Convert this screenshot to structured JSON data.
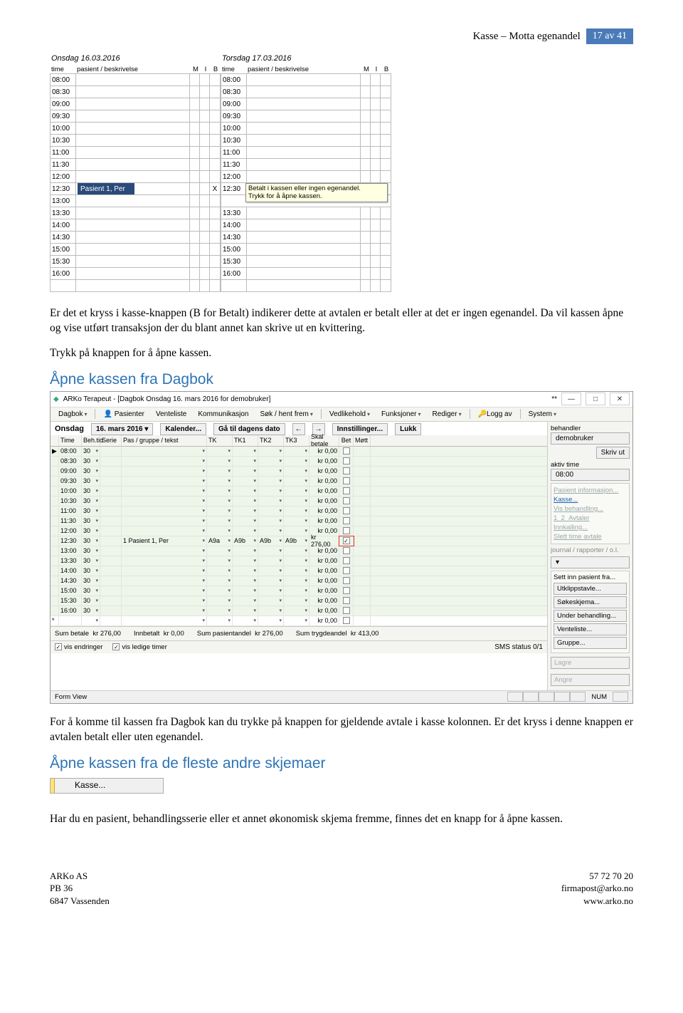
{
  "header": {
    "title": "Kasse – Motta egenandel",
    "page_badge": "17 av 41"
  },
  "schedule": {
    "day1_title": "Onsdag 16.03.2016",
    "day2_title": "Torsdag 17.03.2016",
    "col_time": "time",
    "col_patient": "pasient / beskrivelse",
    "col_m": "M",
    "col_i": "I",
    "col_b": "B",
    "times": [
      "08:00",
      "08:30",
      "09:00",
      "09:30",
      "10:00",
      "10:30",
      "11:00",
      "11:30",
      "12:00",
      "12:30",
      "13:00",
      "13:30",
      "14:00",
      "14:30",
      "15:00",
      "15:30",
      "16:00"
    ],
    "selected_time": "12:30",
    "selected_patient": "Pasient 1, Per",
    "selected_b": "X",
    "tooltip_line1": "Betalt i kassen eller ingen egenandel.",
    "tooltip_line2": "Trykk for å åpne kassen."
  },
  "text": {
    "p1": "Er det et kryss i kasse-knappen (B for Betalt) indikerer dette at avtalen er betalt eller at det er ingen egenandel. Da vil kassen åpne og vise utført transaksjon der du blant annet kan skrive ut en kvittering.",
    "p2": "Trykk på knappen for å åpne kassen.",
    "h_dagbok": "Åpne kassen fra Dagbok",
    "p3": "For å komme til kassen fra Dagbok kan du trykke på knappen for gjeldende avtale i kasse kolonnen. Er det kryss i denne knappen er avtalen betalt eller uten egenandel.",
    "h_other": "Åpne kassen fra de fleste andre skjemaer",
    "p4": "Har du en pasient, behandlingsserie eller et annet økonomisk skjema fremme, finnes det en knapp for å åpne kassen.",
    "kasse_button": "Kasse..."
  },
  "app": {
    "title": "ARKo Terapeut - [Dagbok  Onsdag 16. mars 2016 for demobruker]",
    "win_min": "—",
    "win_max": "□",
    "win_close": "✕",
    "star": "**",
    "menu": [
      "Dagbok",
      "Pasienter",
      "Venteliste",
      "Kommunikasjon",
      "Søk / hent frem",
      "Vedlikehold",
      "Funksjoner",
      "Rediger",
      "Logg av",
      "System"
    ],
    "menu_caret": [
      true,
      false,
      false,
      false,
      true,
      true,
      true,
      true,
      false,
      true
    ],
    "menu_icon_pas": "👤",
    "toolbar": {
      "day_label": "Onsdag",
      "date": "16. mars 2016",
      "kalender": "Kalender...",
      "gaatil": "Gå til dagens dato",
      "prev": "←",
      "next": "→",
      "innst": "Innstillinger...",
      "lukk": "Lukk"
    },
    "side": {
      "behandler_label": "behandler",
      "behandler_value": "demobruker",
      "skrivut": "Skriv ut",
      "aktiv_label": "aktiv time",
      "aktiv_value": "08:00",
      "pasientinfo": "Pasient informasjon...",
      "kasse": "Kasse...",
      "visbeh": "Vis behandling...",
      "avtaler": "Avtaler",
      "innkalling": "Innkalling...",
      "slett": "Slett time avtale",
      "journal": "journal / rapporter / o.l.",
      "settinn": "Sett inn pasient fra...",
      "utklipp": "Utklippstavle...",
      "soke": "Søkeskjema...",
      "under": "Under behandling...",
      "vente": "Venteliste...",
      "gruppe": "Gruppe...",
      "lagre": "Lagre",
      "angre": "Angre"
    },
    "grid": {
      "headers": [
        "Time",
        "Beh.tid",
        "Serie",
        "Pas / gruppe / tekst",
        "TK",
        "TK1",
        "TK2",
        "TK3",
        "Skal betale",
        "Bet",
        "Møtt"
      ],
      "rows": [
        {
          "time": "08:00",
          "beh": "30",
          "pas": "",
          "tk": [
            "",
            "",
            "",
            ""
          ],
          "sk": "kr 0,00",
          "bet": false,
          "hl": false
        },
        {
          "time": "08:30",
          "beh": "30",
          "pas": "",
          "tk": [
            "",
            "",
            "",
            ""
          ],
          "sk": "kr 0,00",
          "bet": false,
          "hl": false
        },
        {
          "time": "09:00",
          "beh": "30",
          "pas": "",
          "tk": [
            "",
            "",
            "",
            ""
          ],
          "sk": "kr 0,00",
          "bet": false,
          "hl": false
        },
        {
          "time": "09:30",
          "beh": "30",
          "pas": "",
          "tk": [
            "",
            "",
            "",
            ""
          ],
          "sk": "kr 0,00",
          "bet": false,
          "hl": false
        },
        {
          "time": "10:00",
          "beh": "30",
          "pas": "",
          "tk": [
            "",
            "",
            "",
            ""
          ],
          "sk": "kr 0,00",
          "bet": false,
          "hl": false
        },
        {
          "time": "10:30",
          "beh": "30",
          "pas": "",
          "tk": [
            "",
            "",
            "",
            ""
          ],
          "sk": "kr 0,00",
          "bet": false,
          "hl": false
        },
        {
          "time": "11:00",
          "beh": "30",
          "pas": "",
          "tk": [
            "",
            "",
            "",
            ""
          ],
          "sk": "kr 0,00",
          "bet": false,
          "hl": false
        },
        {
          "time": "11:30",
          "beh": "30",
          "pas": "",
          "tk": [
            "",
            "",
            "",
            ""
          ],
          "sk": "kr 0,00",
          "bet": false,
          "hl": false
        },
        {
          "time": "12:00",
          "beh": "30",
          "pas": "",
          "tk": [
            "",
            "",
            "",
            ""
          ],
          "sk": "kr 0,00",
          "bet": false,
          "hl": false
        },
        {
          "time": "12:30",
          "beh": "30",
          "pas": "1 Pasient 1, Per",
          "tk": [
            "A9a",
            "A9b",
            "A9b",
            "A9b"
          ],
          "sk": "kr 276,00",
          "bet": true,
          "hl": true
        },
        {
          "time": "13:00",
          "beh": "30",
          "pas": "",
          "tk": [
            "",
            "",
            "",
            ""
          ],
          "sk": "kr 0,00",
          "bet": false,
          "hl": false
        },
        {
          "time": "13:30",
          "beh": "30",
          "pas": "",
          "tk": [
            "",
            "",
            "",
            ""
          ],
          "sk": "kr 0,00",
          "bet": false,
          "hl": false
        },
        {
          "time": "14:00",
          "beh": "30",
          "pas": "",
          "tk": [
            "",
            "",
            "",
            ""
          ],
          "sk": "kr 0,00",
          "bet": false,
          "hl": false
        },
        {
          "time": "14:30",
          "beh": "30",
          "pas": "",
          "tk": [
            "",
            "",
            "",
            ""
          ],
          "sk": "kr 0,00",
          "bet": false,
          "hl": false
        },
        {
          "time": "15:00",
          "beh": "30",
          "pas": "",
          "tk": [
            "",
            "",
            "",
            ""
          ],
          "sk": "kr 0,00",
          "bet": false,
          "hl": false
        },
        {
          "time": "15:30",
          "beh": "30",
          "pas": "",
          "tk": [
            "",
            "",
            "",
            ""
          ],
          "sk": "kr 0,00",
          "bet": false,
          "hl": false
        },
        {
          "time": "16:00",
          "beh": "30",
          "pas": "",
          "tk": [
            "",
            "",
            "",
            ""
          ],
          "sk": "kr 0,00",
          "bet": false,
          "hl": false
        }
      ],
      "final_sk": "kr 0,00",
      "footer": {
        "sumbet_l": "Sum betale",
        "sumbet_v": "kr 276,00",
        "innb_l": "Innbetalt",
        "innb_v": "kr 0,00",
        "sump_l": "Sum pasientandel",
        "sump_v": "kr 276,00",
        "sumt_l": "Sum trygdeandel",
        "sumt_v": "kr 413,00"
      },
      "checks": {
        "endringer": "vis endringer",
        "ledige": "vis ledige timer"
      }
    },
    "status": {
      "sms": "SMS status 0/1",
      "form": "Form View",
      "num": "NUM"
    }
  },
  "footer": {
    "l1": "ARKo AS",
    "l2": "PB 36",
    "l3": "6847 Vassenden",
    "r1": "57 72 70 20",
    "r2": "firmapost@arko.no",
    "r3": "www.arko.no"
  }
}
